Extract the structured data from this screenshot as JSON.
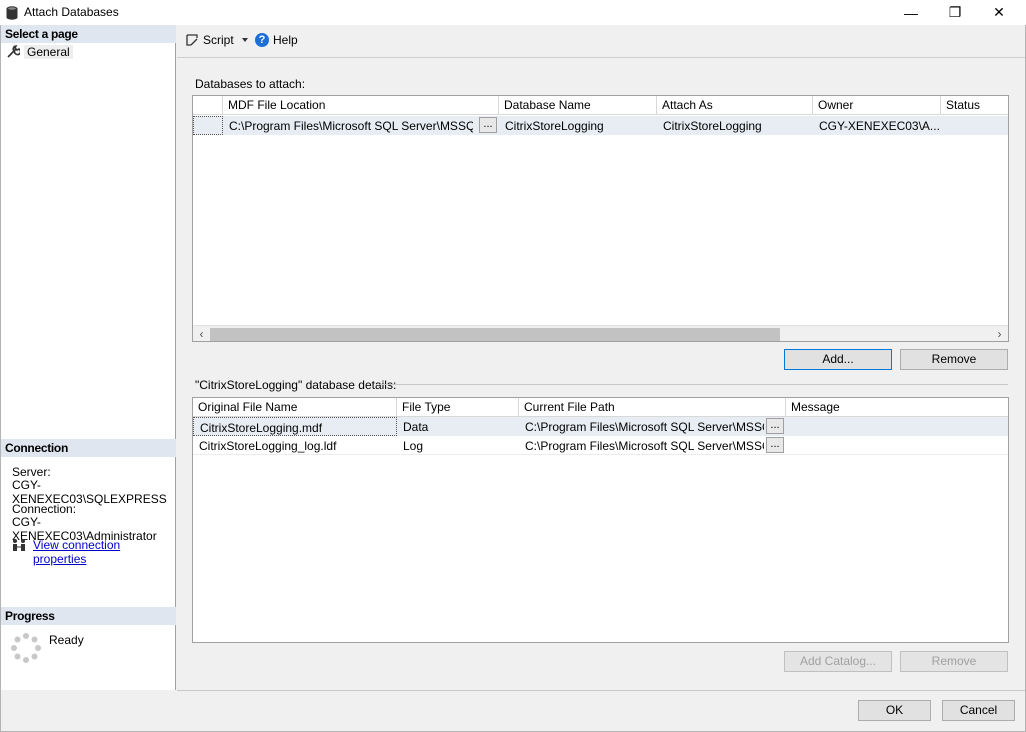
{
  "window": {
    "title": "Attach Databases",
    "minimize": "—",
    "maximize": "❐",
    "close": "✕"
  },
  "left": {
    "select_page_header": "Select a page",
    "pages": [
      {
        "label": "General"
      }
    ],
    "connection_header": "Connection",
    "server_label": "Server:",
    "server_value": "CGY-XENEXEC03\\SQLEXPRESS",
    "connection_label": "Connection:",
    "connection_value": "CGY-XENEXEC03\\Administrator",
    "view_props_link": "View connection properties",
    "progress_header": "Progress",
    "progress_status": "Ready"
  },
  "toolbar": {
    "script_label": "Script",
    "help_label": "Help"
  },
  "databases": {
    "group_label": "Databases to attach:",
    "columns": [
      "MDF File Location",
      "Database Name",
      "Attach As",
      "Owner",
      "Status"
    ],
    "rows": [
      {
        "mdf": "C:\\Program Files\\Microsoft SQL Server\\MSSQL...",
        "db_name": "CitrixStoreLogging",
        "attach_as": "CitrixStoreLogging",
        "owner": "CGY-XENEXEC03\\A...",
        "status": ""
      }
    ],
    "add_button": "Add...",
    "remove_button": "Remove"
  },
  "details": {
    "group_label": "\"CitrixStoreLogging\" database details:",
    "columns": [
      "Original File Name",
      "File Type",
      "Current File Path",
      "Message"
    ],
    "rows": [
      {
        "name": "CitrixStoreLogging.mdf",
        "type": "Data",
        "path": "C:\\Program Files\\Microsoft SQL Server\\MSSQ...",
        "message": ""
      },
      {
        "name": "CitrixStoreLogging_log.ldf",
        "type": "Log",
        "path": "C:\\Program Files\\Microsoft SQL Server\\MSSQ...",
        "message": ""
      }
    ],
    "add_catalog_button": "Add Catalog...",
    "remove_button": "Remove"
  },
  "footer": {
    "ok_button": "OK",
    "cancel_button": "Cancel"
  },
  "ellipsis": "..."
}
